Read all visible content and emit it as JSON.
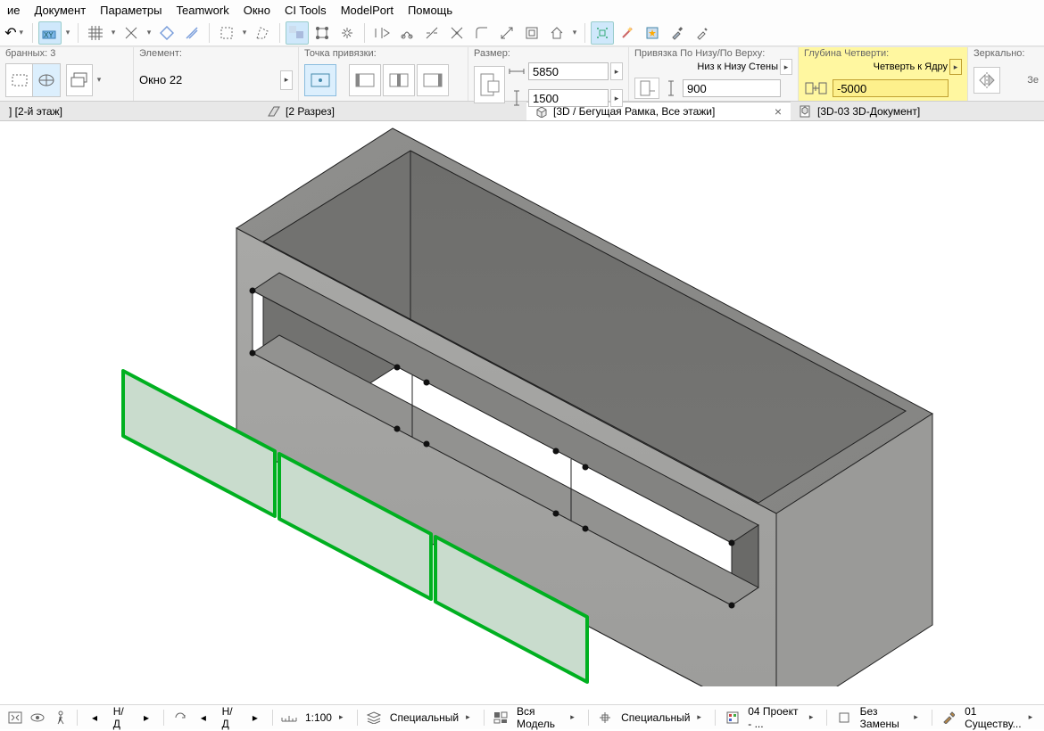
{
  "menu": [
    "ие",
    "Документ",
    "Параметры",
    "Teamwork",
    "Окно",
    "CI Tools",
    "ModelPort",
    "Помощь"
  ],
  "params": {
    "selection": {
      "count_label": "бранных: 3"
    },
    "element": {
      "title": "Элемент:",
      "name": "Окно 22"
    },
    "anchor_point": {
      "title": "Точка привязки:"
    },
    "size": {
      "title": "Размер:",
      "w": "5850",
      "h": "1500"
    },
    "anchor_tb": {
      "title": "Привязка По Низу/По Верху:",
      "label": "Низ к Низу Стены",
      "value": "900"
    },
    "reveal": {
      "title": "Глубина Четверти:",
      "label": "Четверть к Ядру",
      "value": "-5000"
    },
    "mirror": {
      "title": "Зеркально:",
      "short": "Зе"
    }
  },
  "tabs": [
    {
      "label": "] [2-й этаж]",
      "active": false
    },
    {
      "label": "[2 Разрез]",
      "active": false
    },
    {
      "label": "[3D / Бегущая Рамка, Все этажи]",
      "active": true
    },
    {
      "label": "[3D-03 3D-Документ]",
      "active": false
    }
  ],
  "status": {
    "nd1": "Н/Д",
    "nd2": "Н/Д",
    "scale": "1:100",
    "layers": "Специальный",
    "model": "Вся Модель",
    "partial": "Специальный",
    "project": "04 Проект - ...",
    "renov": "Без Замены",
    "existing": "01 Существу..."
  }
}
